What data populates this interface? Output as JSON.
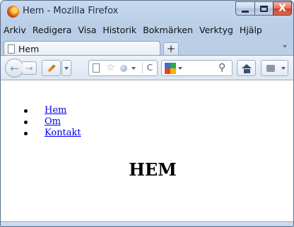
{
  "window": {
    "title": "Hem - Mozilla Firefox"
  },
  "window_controls": {
    "minimize": "minimize",
    "maximize": "maximize",
    "close": "X"
  },
  "menu": [
    "Arkiv",
    "Redigera",
    "Visa",
    "Historik",
    "Bokmärken",
    "Verktyg",
    "Hjälp"
  ],
  "tabs": [
    {
      "label": "Hem"
    }
  ],
  "new_tab_label": "+",
  "toolbar": {
    "back": "←",
    "forward": "→",
    "reload": "C",
    "search_icon": "⚲",
    "home": "home-icon",
    "addons": "addons-icon"
  },
  "page": {
    "links": [
      "Hem",
      "Om",
      "Kontakt"
    ],
    "heading": "HEM"
  }
}
